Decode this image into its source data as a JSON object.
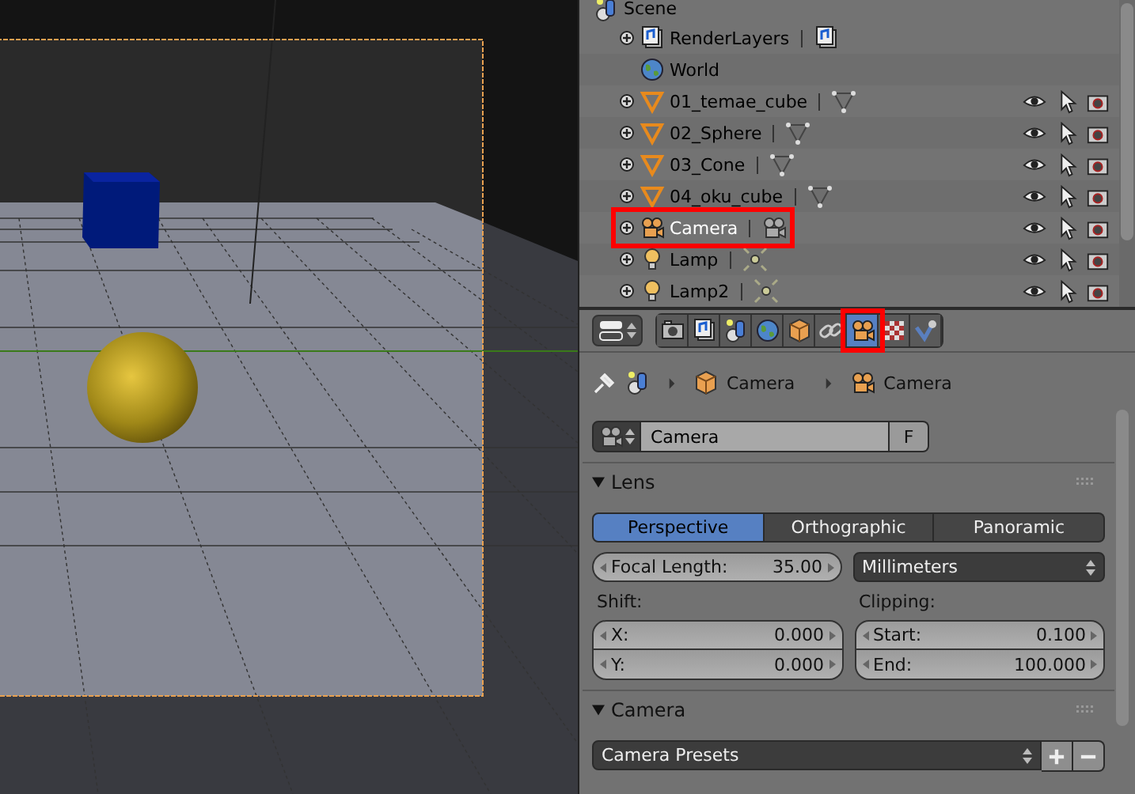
{
  "outliner": {
    "root": {
      "kind": "scene",
      "label": "Scene",
      "children": [
        {
          "kind": "render_layers",
          "label": "RenderLayers",
          "selected": false,
          "highlighted": false
        },
        {
          "kind": "world",
          "label": "World",
          "selected": false,
          "highlighted": false
        },
        {
          "kind": "mesh",
          "label": "01_temae_cube",
          "selected": false,
          "highlighted": false
        },
        {
          "kind": "mesh",
          "label": "02_Sphere",
          "selected": false,
          "highlighted": false
        },
        {
          "kind": "mesh",
          "label": "03_Cone",
          "selected": false,
          "highlighted": false
        },
        {
          "kind": "mesh",
          "label": "04_oku_cube",
          "selected": false,
          "highlighted": false
        },
        {
          "kind": "camera",
          "label": "Camera",
          "selected": true,
          "highlighted": true
        },
        {
          "kind": "lamp",
          "label": "Lamp",
          "selected": false,
          "highlighted": false
        },
        {
          "kind": "lamp",
          "label": "Lamp2",
          "selected": false,
          "highlighted": false
        }
      ]
    }
  },
  "properties": {
    "tabs": [
      {
        "kind": "render",
        "selected": false,
        "highlighted": false
      },
      {
        "kind": "render_layers",
        "selected": false,
        "highlighted": false
      },
      {
        "kind": "scene",
        "selected": false,
        "highlighted": false
      },
      {
        "kind": "world",
        "selected": false,
        "highlighted": false
      },
      {
        "kind": "object",
        "selected": false,
        "highlighted": false
      },
      {
        "kind": "constraints",
        "selected": false,
        "highlighted": false
      },
      {
        "kind": "data",
        "selected": true,
        "highlighted": true
      },
      {
        "kind": "texture",
        "selected": false,
        "highlighted": false
      },
      {
        "kind": "physics",
        "selected": false,
        "highlighted": false
      }
    ],
    "breadcrumb": [
      {
        "kind": "object",
        "label": "Camera"
      },
      {
        "kind": "camera",
        "label": "Camera"
      }
    ],
    "datablock": {
      "value": "Camera",
      "fake_user": "F"
    },
    "lens": {
      "title": "Lens",
      "expanded": true,
      "projection": [
        {
          "label": "Perspective",
          "selected": true
        },
        {
          "label": "Orthographic",
          "selected": false
        },
        {
          "label": "Panoramic",
          "selected": false
        }
      ],
      "focal_length": {
        "label": "Focal Length:",
        "value": "35.00"
      },
      "unit": "Millimeters",
      "shift": {
        "label": "Shift:",
        "fields": [
          {
            "label": "X:",
            "value": "0.000"
          },
          {
            "label": "Y:",
            "value": "0.000"
          }
        ]
      },
      "clipping": {
        "label": "Clipping:",
        "fields": [
          {
            "label": "Start:",
            "value": "0.100"
          },
          {
            "label": "End:",
            "value": "100.000"
          }
        ]
      }
    },
    "camera": {
      "title": "Camera",
      "expanded": true,
      "presets": "Camera Presets"
    }
  }
}
